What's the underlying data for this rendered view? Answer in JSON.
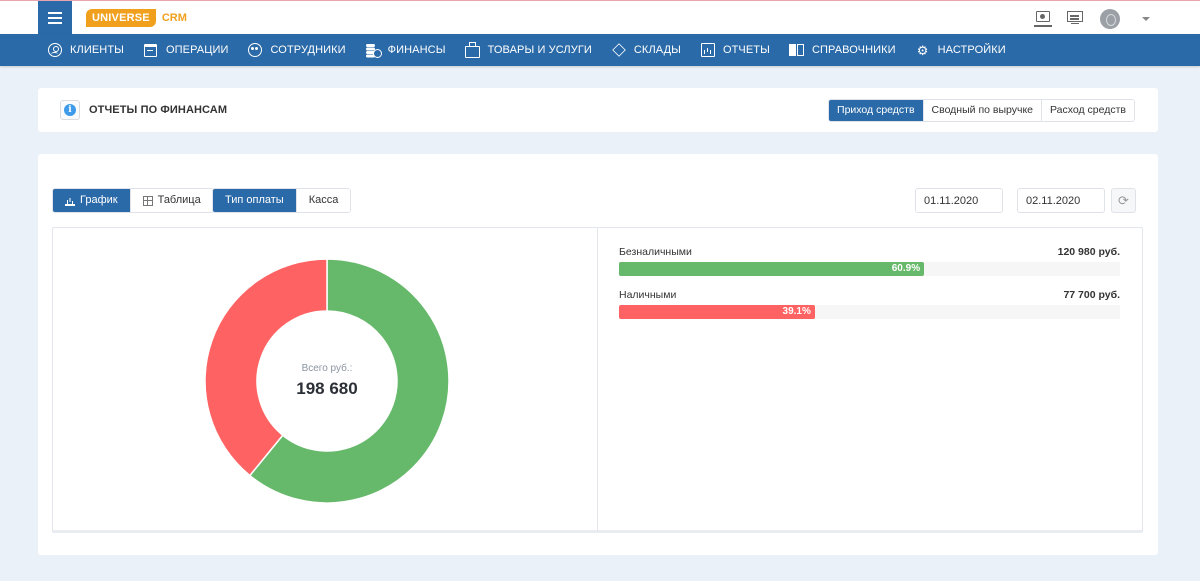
{
  "app": {
    "logo_main": "UNIVERSE",
    "logo_sub": "CRM"
  },
  "topbar": {
    "icons": [
      "monitor-icon",
      "presentation-icon",
      "avatar",
      "chevron-down-icon"
    ]
  },
  "nav": {
    "items": [
      {
        "label": "КЛИЕНТЫ",
        "icon": "user-circle-icon"
      },
      {
        "label": "ОПЕРАЦИИ",
        "icon": "calendar-icon"
      },
      {
        "label": "СОТРУДНИКИ",
        "icon": "team-icon"
      },
      {
        "label": "ФИНАНСЫ",
        "icon": "coins-icon"
      },
      {
        "label": "ТОВАРЫ И УСЛУГИ",
        "icon": "briefcase-icon"
      },
      {
        "label": "СКЛАДЫ",
        "icon": "layers-icon"
      },
      {
        "label": "ОТЧЕТЫ",
        "icon": "bar-chart-icon"
      },
      {
        "label": "СПРАВОЧНИКИ",
        "icon": "book-icon"
      },
      {
        "label": "НАСТРОЙКИ",
        "icon": "gear-icon"
      }
    ]
  },
  "header": {
    "title": "ОТЧЕТЫ ПО ФИНАНСАМ",
    "tabs": [
      {
        "label": "Приход средств",
        "active": true
      },
      {
        "label": "Сводный по выручке",
        "active": false
      },
      {
        "label": "Расход средств",
        "active": false
      }
    ]
  },
  "toolbar": {
    "view_buttons": [
      {
        "label": "График",
        "icon": "chart-icon",
        "active": true
      },
      {
        "label": "Таблица",
        "icon": "table-icon",
        "active": false
      }
    ],
    "group_buttons": [
      {
        "label": "Тип оплаты",
        "active": true
      },
      {
        "label": "Касса",
        "active": false
      }
    ],
    "date_from": "01.11.2020",
    "date_to": "02.11.2020",
    "refresh_icon": "refresh-icon"
  },
  "summary": {
    "total_label": "Всего руб.:",
    "total_value": "198 680"
  },
  "colors": {
    "primary": "#2a6aa8",
    "accent": "#f0a01d",
    "green": "#66b96a",
    "red": "#ff6262"
  },
  "chart_data": {
    "type": "pie",
    "title": "Всего руб.: 198 680",
    "series": [
      {
        "name": "Безналичными",
        "value": 120980,
        "amount_label": "120 980 руб.",
        "percent": 60.9,
        "percent_label": "60.9%",
        "color": "#66b96a"
      },
      {
        "name": "Наличными",
        "value": 77700,
        "amount_label": "77 700 руб.",
        "percent": 39.1,
        "percent_label": "39.1%",
        "color": "#ff6262"
      }
    ],
    "total": 198680
  }
}
